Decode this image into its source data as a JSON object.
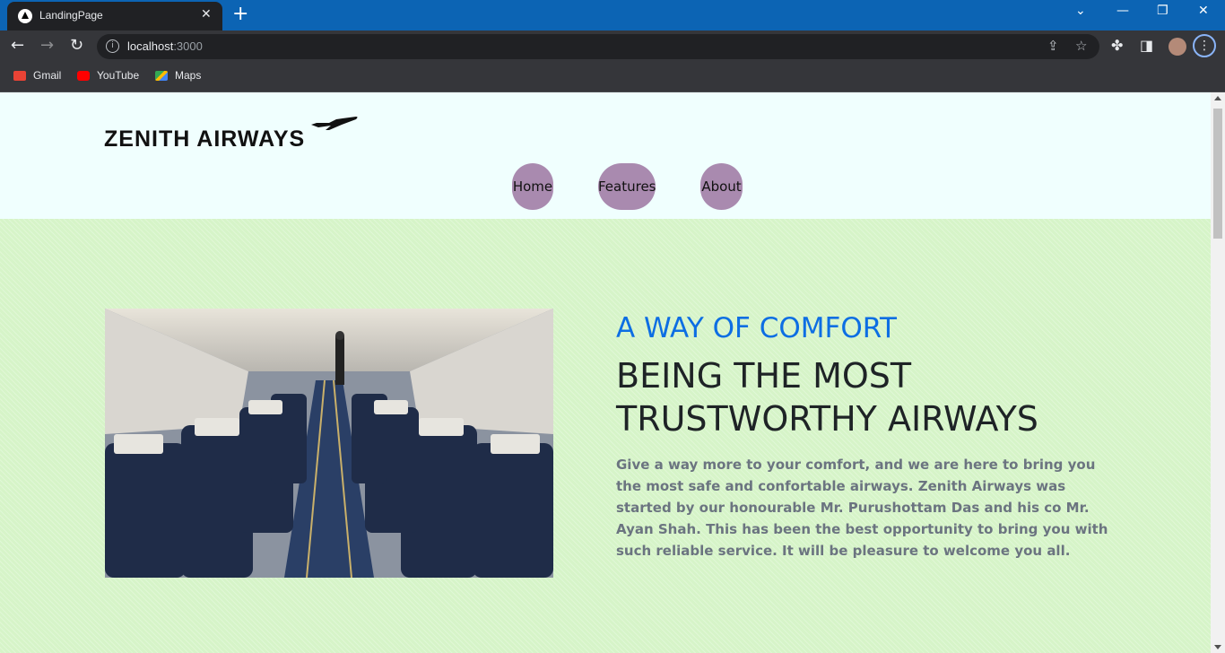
{
  "browser": {
    "tab_title": "LandingPage",
    "tab_close": "✕",
    "new_tab": "+",
    "url_host": "localhost",
    "url_port": ":3000",
    "bookmarks": [
      {
        "label": "Gmail",
        "icon": "gmail-icon",
        "color": "#ea4335"
      },
      {
        "label": "YouTube",
        "icon": "youtube-icon",
        "color": "#ff0000"
      },
      {
        "label": "Maps",
        "icon": "maps-icon",
        "color": "#34a853"
      }
    ]
  },
  "site": {
    "logo": "ZENITH AIRWAYS",
    "nav": [
      "Home",
      "Features",
      "About"
    ],
    "nav_color": "#a98aaf"
  },
  "hero": {
    "eyebrow": "A WAY OF COMFORT",
    "title": "BEING THE MOST TRUSTWORTHY AIRWAYS",
    "body": "Give a way more to your comfort, and we are here to bring you the most safe and confortable airways. Zenith Airways was started by our honourable Mr. Purushottam Das and his co Mr. Ayan Shah. This has been the best opportunity to bring you with such reliable service. It will be pleasure to welcome you all.",
    "eyebrow_color": "#0d6ee3",
    "background_color": "#d6f4c8"
  }
}
